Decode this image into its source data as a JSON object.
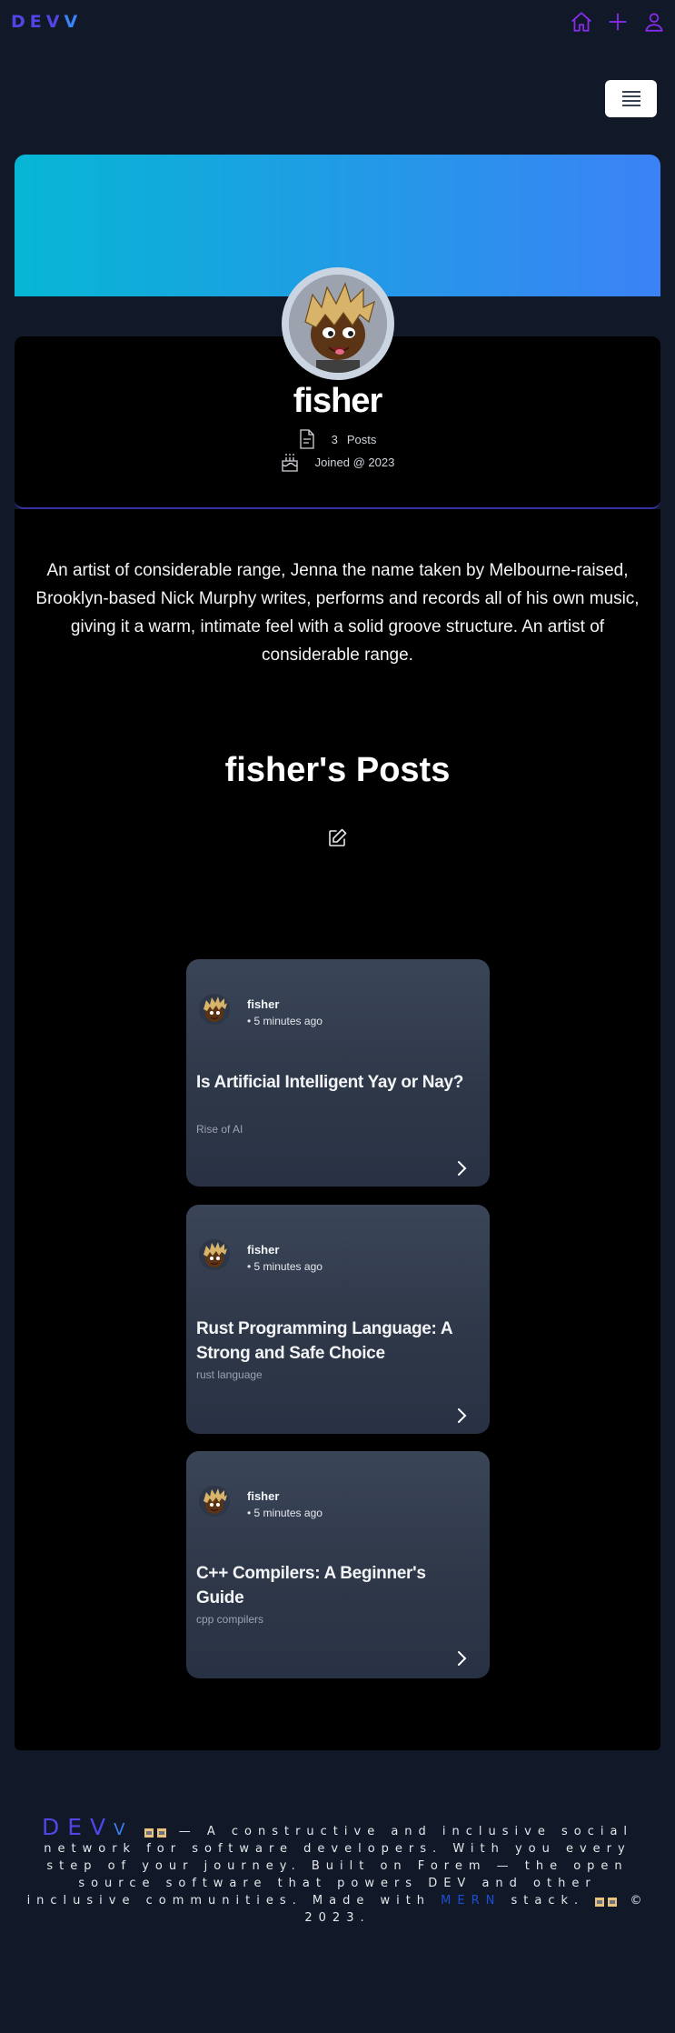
{
  "header": {
    "logo_main": "DEV",
    "logo_tail": "V"
  },
  "profile": {
    "username": "fisher",
    "posts_count": "3",
    "posts_label": "Posts",
    "joined": "Joined @ 2023",
    "bio": "An artist of considerable range, Jenna the name taken by Melbourne-raised, Brooklyn-based Nick Murphy writes, performs and records all of his own music, giving it a warm, intimate feel with a solid groove structure. An artist of considerable range."
  },
  "posts_section": {
    "title": "fisher's Posts"
  },
  "posts": [
    {
      "author": "fisher",
      "time": "• 5 minutes ago",
      "title": "Is Artificial Intelligent Yay or Nay?",
      "tag": "Rise of AI"
    },
    {
      "author": "fisher",
      "time": "• 5 minutes ago",
      "title": "Rust Programming Language: A Strong and Safe Choice",
      "tag": "rust language"
    },
    {
      "author": "fisher",
      "time": "• 5 minutes ago",
      "title": "C++ Compilers: A Beginner's Guide",
      "tag": "cpp compilers"
    }
  ],
  "footer": {
    "logo_main": "DEV",
    "logo_tail": "V",
    "text_1": "— A constructive and inclusive social network for software developers. With you every step of your journey. Built on Forem — the open source software that powers DEV and other inclusive communities. Made with",
    "mern": "MERN",
    "text_2": "stack.",
    "copyright": "© 2023."
  },
  "colors": {
    "background": "#111827",
    "brand": "#4f46e5",
    "accent": "#3b82f6",
    "nav_icon": "#8b2cf5"
  }
}
